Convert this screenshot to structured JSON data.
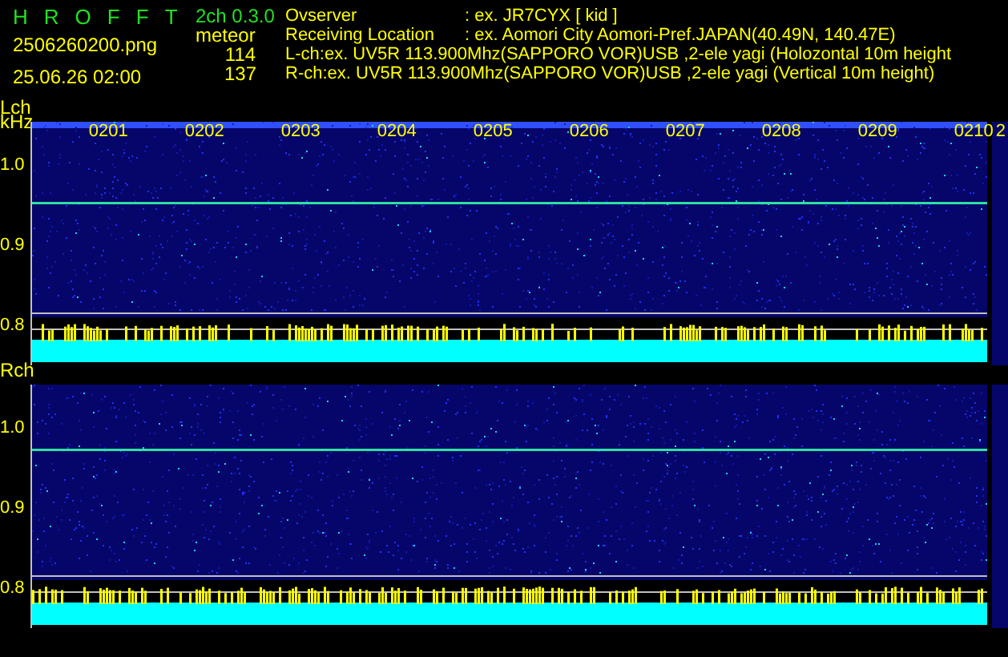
{
  "header": {
    "title_letters": [
      "H",
      "R",
      "O",
      "F",
      "F",
      "T"
    ],
    "version": "2ch 0.3.0",
    "filename": "2506260200.png",
    "datetime": "25.06.26 02:00",
    "meteor_label": "meteor",
    "meteor_counts": [
      "114",
      "137"
    ],
    "info": [
      {
        "label": "Ovserver",
        "value": ": ex. JR7CYX [ kid ]"
      },
      {
        "label": "Receiving Location",
        "value": ": ex. Aomori City Aomori-Pref.JAPAN(40.49N, 140.47E)"
      },
      {
        "value": "L-ch:ex. UV5R 113.900Mhz(SAPPORO VOR)USB ,2-ele yagi (Holozontal 10m height"
      },
      {
        "value": "R-ch:ex. UV5R 113.900Mhz(SAPPORO VOR)USB ,2-ele yagi (Vertical 10m height)"
      }
    ]
  },
  "channels": [
    {
      "label": "Lch",
      "unit": "kHz",
      "ticks": [
        "1.0",
        "0.9",
        "0.8"
      ],
      "time_labels": [
        "0201",
        "0202",
        "0203",
        "0204",
        "0205",
        "0206",
        "0207",
        "0208",
        "0209",
        "0210",
        "2"
      ]
    },
    {
      "label": "Rch",
      "ticks": [
        "1.0",
        "0.9",
        "0.8"
      ]
    }
  ]
}
